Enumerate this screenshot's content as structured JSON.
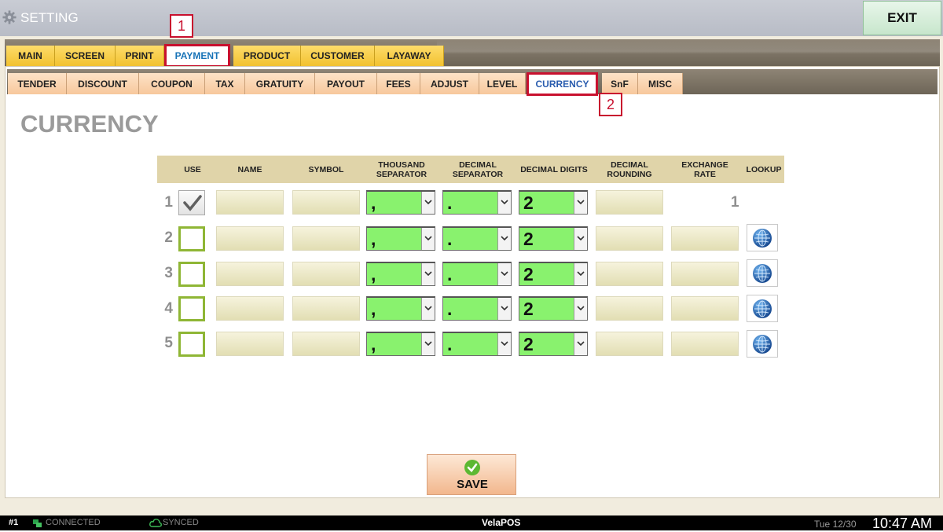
{
  "window": {
    "title": "SETTING",
    "exit_label": "EXIT"
  },
  "main_tabs": [
    "MAIN",
    "SCREEN",
    "PRINT",
    "PAYMENT",
    "PRODUCT",
    "CUSTOMER",
    "LAYAWAY"
  ],
  "main_tab_active": "PAYMENT",
  "sub_tabs": [
    "TENDER",
    "DISCOUNT",
    "COUPON",
    "TAX",
    "GRATUITY",
    "PAYOUT",
    "FEES",
    "ADJUST",
    "LEVEL",
    "CURRENCY",
    "SnF",
    "MISC"
  ],
  "sub_tab_active": "CURRENCY",
  "annotations": [
    "1",
    "2"
  ],
  "page_title": "CURRENCY",
  "columns": {
    "use": "USE",
    "name": "NAME",
    "symbol": "SYMBOL",
    "thousand_separator": "THOUSAND SEPARATOR",
    "decimal_separator": "DECIMAL SEPARATOR",
    "decimal_digits": "DECIMAL DIGITS",
    "decimal_rounding": "DECIMAL ROUNDING",
    "exchange_rate": "EXCHANGE RATE",
    "lookup": "LOOKUP"
  },
  "rows": [
    {
      "num": "1",
      "use": true,
      "name": "",
      "symbol": "",
      "thousand_sep": ",",
      "decimal_sep": ".",
      "decimal_digits": "2",
      "decimal_rounding": "",
      "exchange_rate": "1"
    },
    {
      "num": "2",
      "use": false,
      "name": "",
      "symbol": "",
      "thousand_sep": ",",
      "decimal_sep": ".",
      "decimal_digits": "2",
      "decimal_rounding": "",
      "exchange_rate": ""
    },
    {
      "num": "3",
      "use": false,
      "name": "",
      "symbol": "",
      "thousand_sep": ",",
      "decimal_sep": ".",
      "decimal_digits": "2",
      "decimal_rounding": "",
      "exchange_rate": ""
    },
    {
      "num": "4",
      "use": false,
      "name": "",
      "symbol": "",
      "thousand_sep": ",",
      "decimal_sep": ".",
      "decimal_digits": "2",
      "decimal_rounding": "",
      "exchange_rate": ""
    },
    {
      "num": "5",
      "use": false,
      "name": "",
      "symbol": "",
      "thousand_sep": ",",
      "decimal_sep": ".",
      "decimal_digits": "2",
      "decimal_rounding": "",
      "exchange_rate": ""
    }
  ],
  "save_label": "SAVE",
  "status": {
    "station": "#1",
    "connection": "CONNECTED",
    "sync": "SYNCED",
    "app_name_prefix": "Vela",
    "app_name_suffix": "POS",
    "date": "Tue 12/30",
    "time": "10:47 AM"
  },
  "colors": {
    "tab_yellow": "#f6cb3f",
    "tab_peach": "#f9d3ad",
    "active_outline": "#c8102e",
    "select_green": "#89f26e",
    "checkbox_border": "#8fb635",
    "header_tan": "#e0d4a9"
  },
  "icons": [
    "gear-icon",
    "checkmark-icon",
    "globe-icon",
    "ok-circle-icon",
    "cloud-icon",
    "network-icon",
    "chevron-down-icon"
  ]
}
